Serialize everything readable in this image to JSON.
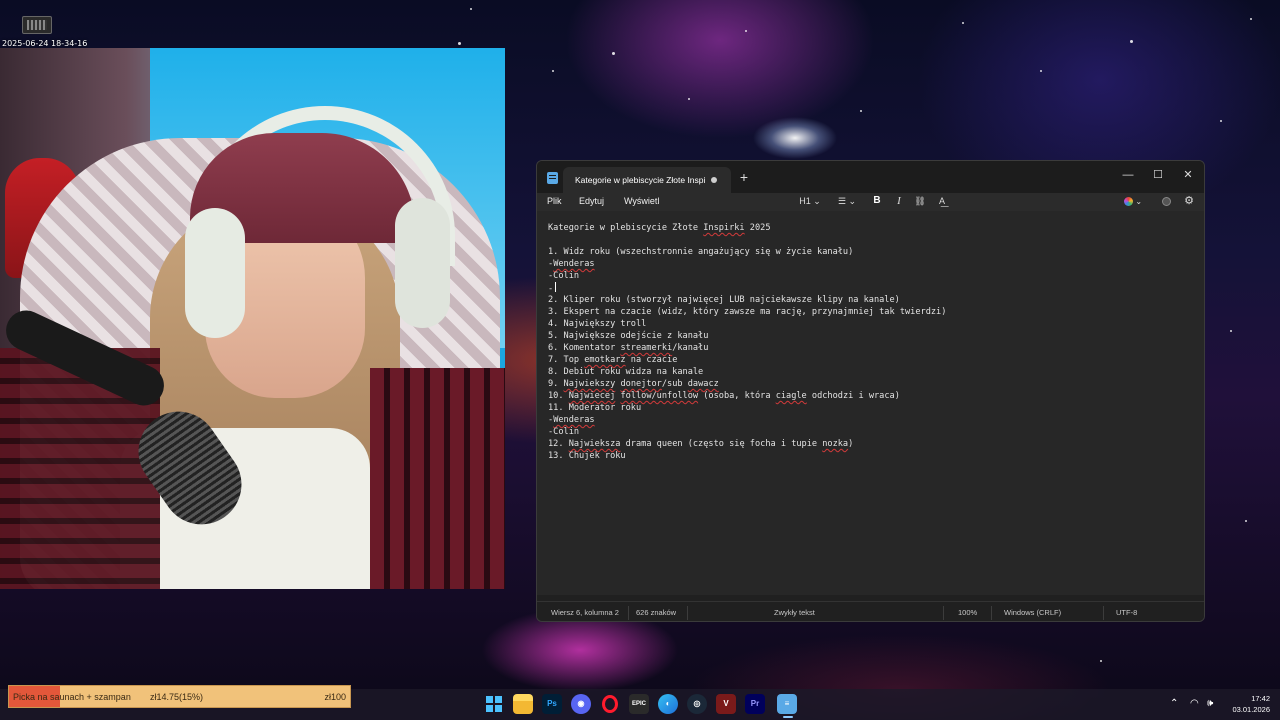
{
  "overlay": {
    "recording_time": "2025-06-24 18-34-16"
  },
  "window": {
    "tab_title": "Kategorie w plebiscycie Złote Inspi",
    "menu": {
      "file": "Plik",
      "edit": "Edytuj",
      "view": "Wyświetl"
    },
    "toolbar": {
      "heading": "H1 ⌄",
      "list": "☰ ⌄",
      "bold": "B",
      "italic": "I",
      "link": "⛓",
      "clear": "A͟",
      "settings": "⚙"
    },
    "document_lines": [
      [
        {
          "t": "Kategorie w plebiscycie Złote "
        },
        {
          "t": "Inspirki",
          "s": true
        },
        {
          "t": " 2025"
        }
      ],
      [],
      [
        {
          "t": "1. Widz roku (wszechstronnie angażujący się w życie kanału)"
        }
      ],
      [
        {
          "t": "-"
        },
        {
          "t": "Wenderas",
          "s": true
        }
      ],
      [
        {
          "t": "-Colin"
        }
      ],
      [
        {
          "t": "-"
        },
        {
          "caret": true
        }
      ],
      [
        {
          "t": "2. Kliper roku (stworzył najwięcej LUB najciekawsze klipy na kanale)"
        }
      ],
      [
        {
          "t": "3. Ekspert na czacie (widz, który zawsze ma rację, przynajmniej tak twierdzi)"
        }
      ],
      [
        {
          "t": "4. Największy troll"
        }
      ],
      [
        {
          "t": "5. Największe odejście z kanału"
        }
      ],
      [
        {
          "t": "6. Komentator "
        },
        {
          "t": "streamerki",
          "s": true
        },
        {
          "t": "/kanału"
        }
      ],
      [
        {
          "t": "7. Top "
        },
        {
          "t": "emotkarz",
          "s": true
        },
        {
          "t": " na czacie"
        }
      ],
      [
        {
          "t": "8. Debiut roku widza na kanale"
        }
      ],
      [
        {
          "t": "9. "
        },
        {
          "t": "Najwiekszy",
          "s": true
        },
        {
          "t": " "
        },
        {
          "t": "donejtor",
          "s": true
        },
        {
          "t": "/sub "
        },
        {
          "t": "dawacz",
          "s": true
        }
      ],
      [
        {
          "t": "10. "
        },
        {
          "t": "Najwiecej",
          "s": true
        },
        {
          "t": " "
        },
        {
          "t": "follow/unfollow",
          "s": true
        },
        {
          "t": " (osoba, która "
        },
        {
          "t": "ciagle",
          "s": true
        },
        {
          "t": " odchodzi i wraca)"
        }
      ],
      [
        {
          "t": "11. Moderator roku"
        }
      ],
      [
        {
          "t": "-"
        },
        {
          "t": "Wenderas",
          "s": true
        }
      ],
      [
        {
          "t": "-Colin"
        }
      ],
      [
        {
          "t": "12. "
        },
        {
          "t": "Najwieksza",
          "s": true
        },
        {
          "t": " drama queen (często się focha i tupie "
        },
        {
          "t": "nozka",
          "s": true
        },
        {
          "t": ")"
        }
      ],
      [
        {
          "t": "13. Chujek roku"
        }
      ]
    ],
    "status": {
      "position": "Wiersz 6, kolumna 2",
      "chars": "626 znaków",
      "format": "Zwykły tekst",
      "zoom": "100%",
      "eol": "Windows (CRLF)",
      "encoding": "UTF-8"
    },
    "controls": {
      "minimize": "—",
      "maximize": "☐",
      "close": "✕",
      "new_tab": "+"
    }
  },
  "donation_goal": {
    "name": "Picka na saunach + szampan",
    "amount": "zł14.75(15%)",
    "target": "zł100",
    "progress": 0.15,
    "color_fill": "#e3573a",
    "color_bg": "#f1c27a"
  },
  "taskbar": {
    "apps": [
      {
        "name": "start-icon",
        "label": ""
      },
      {
        "name": "file-explorer-icon",
        "label": ""
      },
      {
        "name": "photoshop-icon",
        "label": "Ps"
      },
      {
        "name": "discord-icon",
        "label": "◉"
      },
      {
        "name": "opera-icon",
        "label": ""
      },
      {
        "name": "epic-games-icon",
        "label": "EPIC"
      },
      {
        "name": "edge-icon",
        "label": "◐"
      },
      {
        "name": "steam-icon",
        "label": "◎"
      },
      {
        "name": "vegas-icon",
        "label": "V"
      },
      {
        "name": "premiere-icon",
        "label": "Pr"
      },
      {
        "name": "notepad-icon",
        "label": "≡"
      }
    ],
    "tray": {
      "chevron": "⌃",
      "wifi": "◠",
      "volume": "🕪"
    },
    "time": "17:42",
    "date": "03.01.2026"
  }
}
